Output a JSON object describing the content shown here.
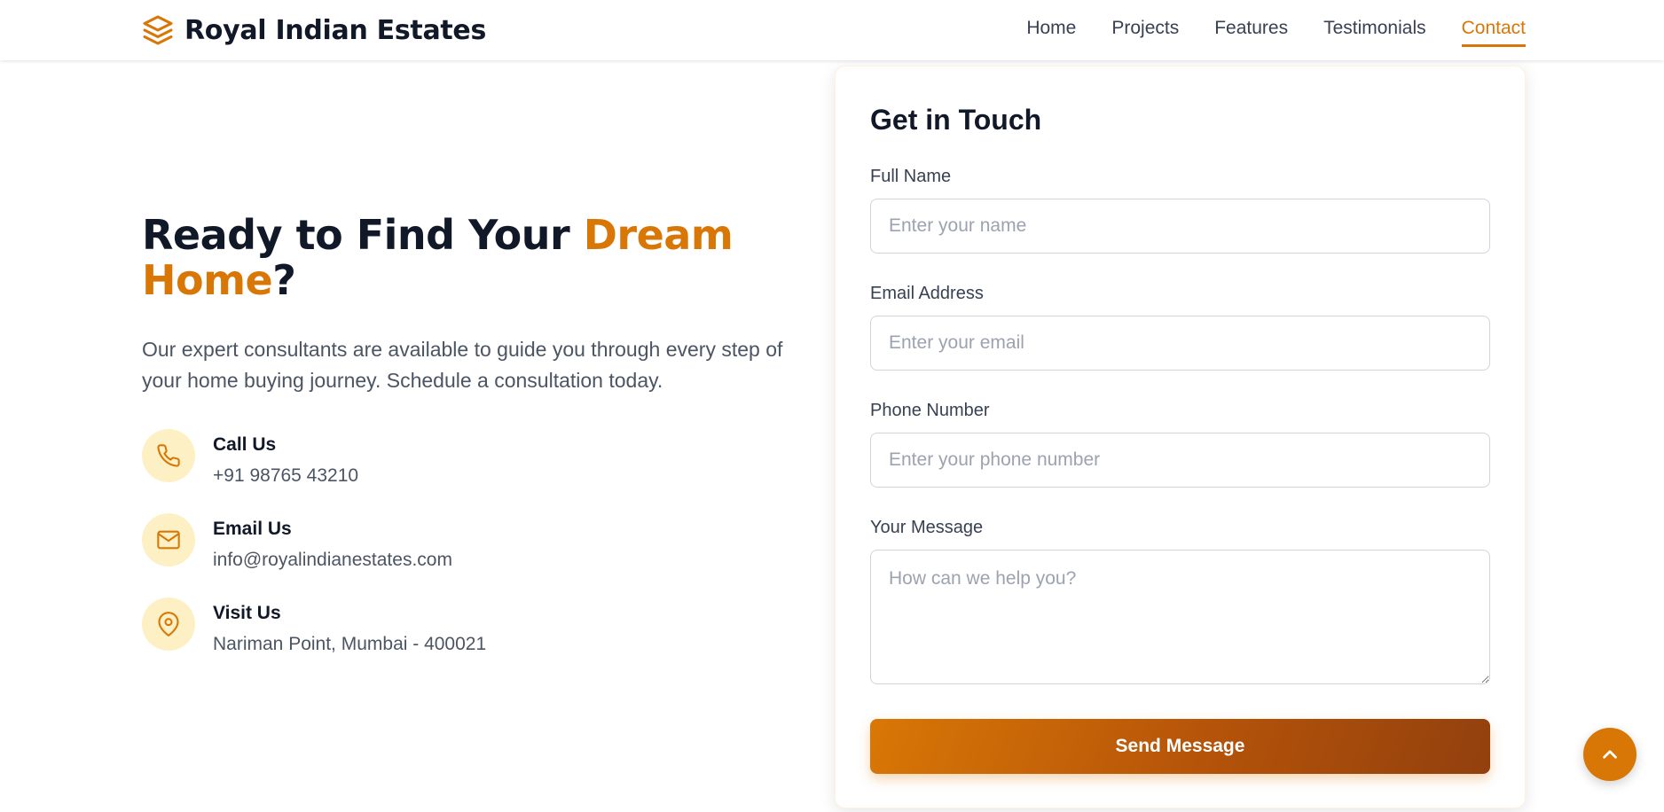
{
  "header": {
    "brand": "Royal Indian Estates",
    "brand_icon": "layers-icon",
    "nav": [
      {
        "label": "Home",
        "active": false
      },
      {
        "label": "Projects",
        "active": false
      },
      {
        "label": "Features",
        "active": false
      },
      {
        "label": "Testimonials",
        "active": false
      },
      {
        "label": "Contact",
        "active": true
      }
    ]
  },
  "hero": {
    "title_part1": "Ready to Find Your ",
    "title_accent": "Dream Home",
    "title_part2": "?",
    "description": "Our expert consultants are available to guide you through every step of your home buying journey. Schedule a consultation today."
  },
  "contacts": [
    {
      "icon": "phone-icon",
      "title": "Call Us",
      "value": "+91 98765 43210"
    },
    {
      "icon": "mail-icon",
      "title": "Email Us",
      "value": "info@royalindianestates.com"
    },
    {
      "icon": "map-pin-icon",
      "title": "Visit Us",
      "value": "Nariman Point, Mumbai - 400021"
    }
  ],
  "form": {
    "title": "Get in Touch",
    "name_label": "Full Name",
    "name_placeholder": "Enter your name",
    "email_label": "Email Address",
    "email_placeholder": "Enter your email",
    "phone_label": "Phone Number",
    "phone_placeholder": "Enter your phone number",
    "message_label": "Your Message",
    "message_placeholder": "How can we help you?",
    "submit_label": "Send Message"
  },
  "scroll_top_icon": "chevron-up-icon",
  "colors": {
    "accent": "#d97706",
    "accent_dark": "#92400e",
    "icon_bg": "#fdf0c4",
    "text_dark": "#111827",
    "text_muted": "#4b5563"
  }
}
